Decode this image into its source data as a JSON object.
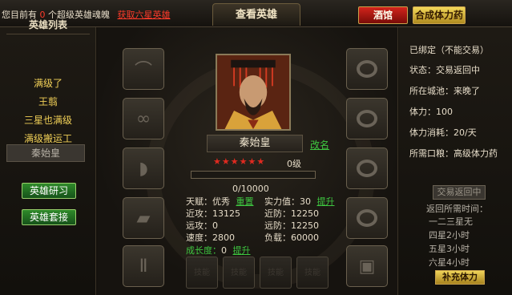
{
  "topbar": {
    "notice_prefix": "您目前有",
    "notice_count": "0",
    "notice_suffix": "个超级英雄魂魄",
    "notice_link": "获取六星英雄",
    "title": "查看英雄",
    "tavern_label": "酒馆",
    "synth_label": "合成体力药"
  },
  "left": {
    "title": "英雄列表",
    "heroes": [
      "满级了",
      "王翦",
      "三星也满级",
      "满级搬运工",
      "秦始皇"
    ],
    "selected_index": 4,
    "train_button": "英雄研习",
    "inherit_button": "英雄套接"
  },
  "hero": {
    "name": "秦始皇",
    "rename_label": "改名",
    "stars": 6,
    "level": "0级",
    "exp_text": "0/10000",
    "exp_fraction": 0,
    "talent_label": "天赋：",
    "talent_value": "优秀",
    "reset_label": "重置",
    "strength_label": "实力值：",
    "strength_value": "30",
    "upgrade_label": "提升",
    "melee_atk_label": "近攻：",
    "melee_atk_value": "13125",
    "melee_def_label": "近防：",
    "melee_def_value": "12250",
    "range_atk_label": "远攻：",
    "range_atk_value": "0",
    "range_def_label": "远防：",
    "range_def_value": "12250",
    "speed_label": "速度：",
    "speed_value": "2800",
    "load_label": "负载：",
    "load_value": "60000",
    "growth_label": "成长度：",
    "growth_value": "0",
    "growth_upgrade_label": "提升"
  },
  "gems": [
    "技能",
    "技能",
    "技能",
    "技能"
  ],
  "right": {
    "bound": "已绑定（不能交易）",
    "status": "状态：交易返回中",
    "city": "所在城池：来晚了",
    "stamina": "体力：100",
    "stamina_cost": "体力消耗：20/天",
    "food": "所需口粮：高级体力药",
    "return_button": "交易返回中",
    "return_time_title": "返回所需时间：",
    "return_times": [
      "一二三星无",
      "四星2小时",
      "五星3小时",
      "六星4小时"
    ],
    "refill_button": "补充体力"
  },
  "colors": {
    "accent_gold": "#f0cf57",
    "link_green": "#3ec640",
    "alert_red": "#ff3b2a"
  },
  "equipment_slots_left": [
    "shoulder-icon",
    "necklace-icon",
    "belt-icon",
    "boots-icon",
    "pants-icon"
  ],
  "equipment_slots_right": [
    "ring-icon",
    "bracelet-icon",
    "ring-icon",
    "ring-icon",
    "token-icon"
  ]
}
